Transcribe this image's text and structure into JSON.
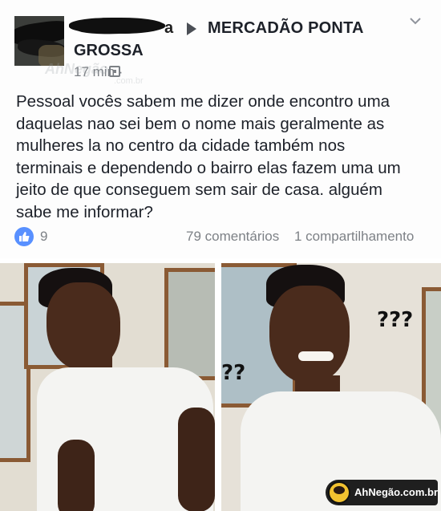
{
  "post": {
    "author_visible_tail": "a",
    "group_name_line1": "MERCADÃO PONTA",
    "group_name_line2": "GROSSA",
    "time": "17 min ·",
    "watermark": "AhNegão",
    "watermark_sub": ".com.br",
    "text_lines": [
      "Pessoal vocês sabem me dizer onde encontro uma",
      "daquelas nao sei bem o nome mais geralmente as",
      "mulheres la no centro da cidade também nos",
      "terminais e dependendo o bairro elas fazem uma um",
      "jeito de que conseguem sem sair de casa. alguém",
      "sabe me informar?"
    ],
    "likes": "9",
    "comments": "79 comentários",
    "shares": "1 compartilhamento"
  },
  "icons": {
    "arrow": "caret-right-icon",
    "chevron": "chevron-down-icon",
    "globe": "audience-icon",
    "like": "thumbs-up-icon",
    "like_color": "#5890ff"
  },
  "meme": {
    "right_qmarks_top": "???",
    "right_qmarks_side": "??"
  },
  "credit": {
    "text": "AhNegão.com.br"
  }
}
